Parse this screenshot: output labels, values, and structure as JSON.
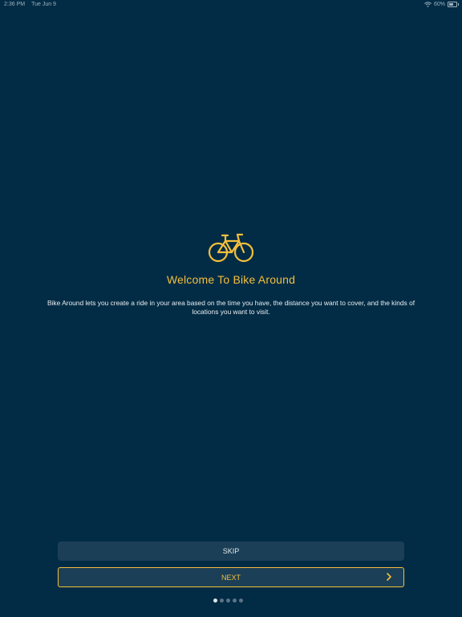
{
  "status_bar": {
    "time": "2:36 PM",
    "date": "Tue Jun 9",
    "battery_percent": "60%",
    "icons": [
      "wifi-icon",
      "battery-icon"
    ]
  },
  "onboarding": {
    "icon": "bicycle-icon",
    "title": "Welcome To Bike Around",
    "description": "Bike Around lets you create a ride in your area based on the time you have, the distance you want to cover, and the kinds of locations you want to visit.",
    "accent_color": "#f5bf3c",
    "background_color": "#022c45"
  },
  "buttons": {
    "skip_label": "SKIP",
    "next_label": "NEXT",
    "next_icon": "chevron-right-icon"
  },
  "pagination": {
    "total_pages": 5,
    "current_page": 1
  }
}
